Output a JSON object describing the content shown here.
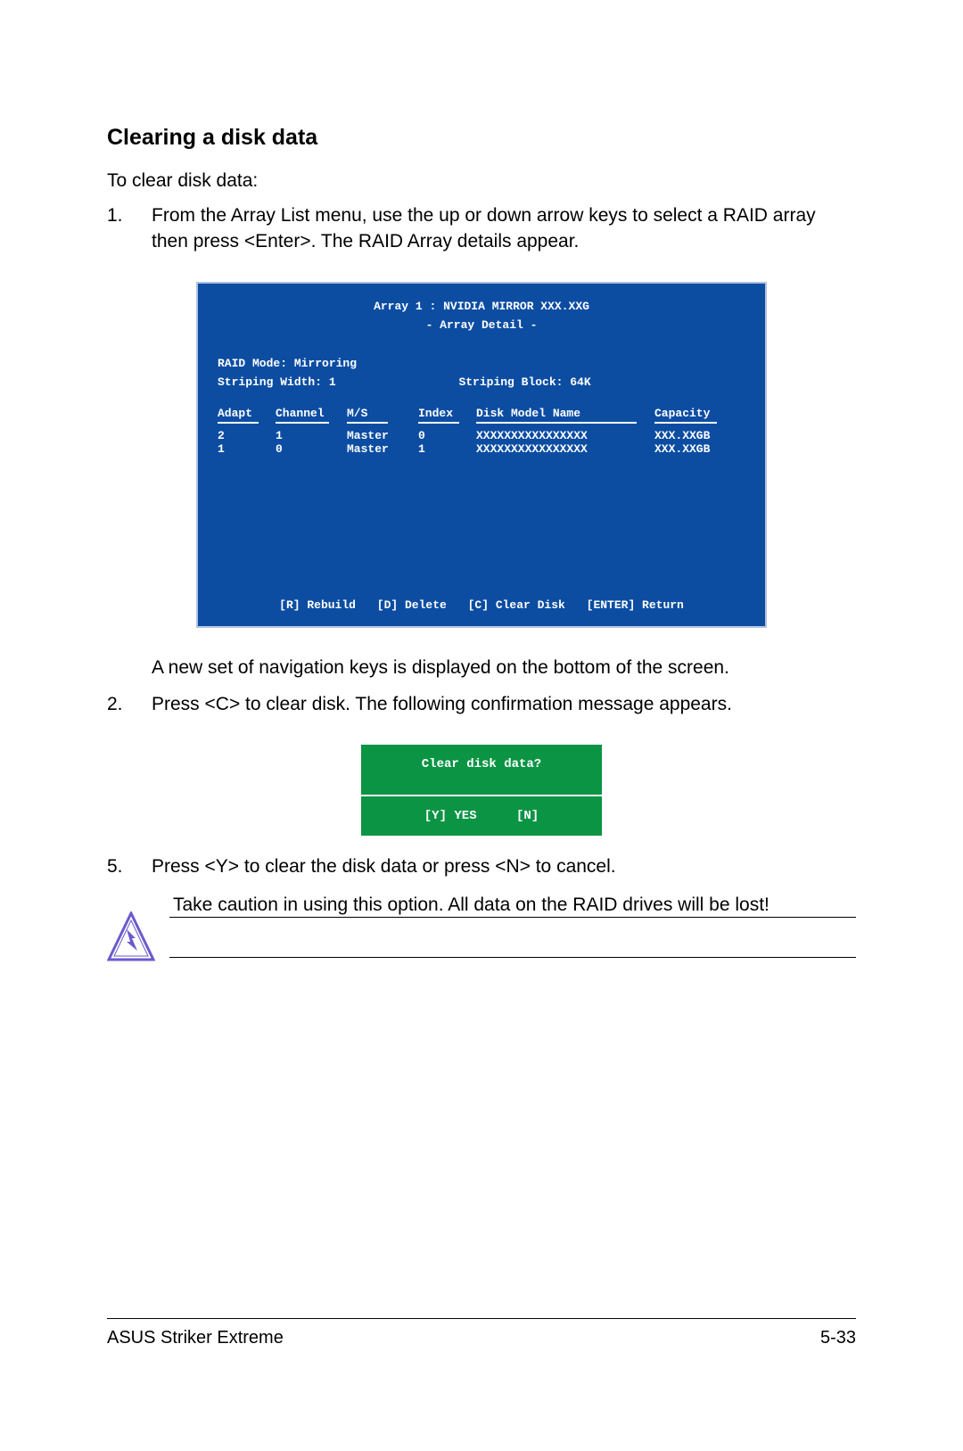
{
  "heading": "Clearing a disk data",
  "intro": "To clear disk data:",
  "steps": {
    "s1": {
      "num": "1.",
      "text": "From the Array List menu, use the up or down arrow keys to select a RAID array then press <Enter>. The RAID Array details appear."
    },
    "after_bios": "A new set of  navigation keys is displayed on the bottom of the screen.",
    "s2": {
      "num": "2.",
      "text": "Press <C> to clear disk. The following confirmation message appears."
    },
    "s5": {
      "num": "5.",
      "text": "Press <Y> to clear the disk data or press <N> to cancel."
    }
  },
  "bios": {
    "title": "Array 1 : NVIDIA MIRROR  XXX.XXG",
    "subtitle": "- Array Detail -",
    "raid_mode_label": "RAID Mode: Mirroring",
    "striping_width_label": "Striping Width: 1",
    "striping_block_label": "Striping Block: 64K",
    "headers": {
      "adapt": "Adapt",
      "channel": "Channel",
      "ms": "M/S",
      "index": "Index",
      "model": "Disk Model Name",
      "capacity": "Capacity"
    },
    "rows": [
      {
        "adapt": "2",
        "channel": "1",
        "ms": "Master",
        "index": "0",
        "model": "XXXXXXXXXXXXXXXX",
        "capacity": "XXX.XXGB"
      },
      {
        "adapt": "1",
        "channel": "0",
        "ms": "Master",
        "index": "1",
        "model": "XXXXXXXXXXXXXXXX",
        "capacity": "XXX.XXGB"
      }
    ],
    "footer": {
      "rebuild": "[R] Rebuild",
      "delete": "[D] Delete",
      "clear": "[C] Clear Disk",
      "return": "[ENTER] Return"
    }
  },
  "dialog": {
    "title": "Clear disk data?",
    "yes": "[Y] YES",
    "no": "[N]"
  },
  "caution": "Take caution in using this option. All data on the RAID drives will be lost!",
  "footer": {
    "product": "ASUS Striker Extreme",
    "page": "5-33"
  }
}
